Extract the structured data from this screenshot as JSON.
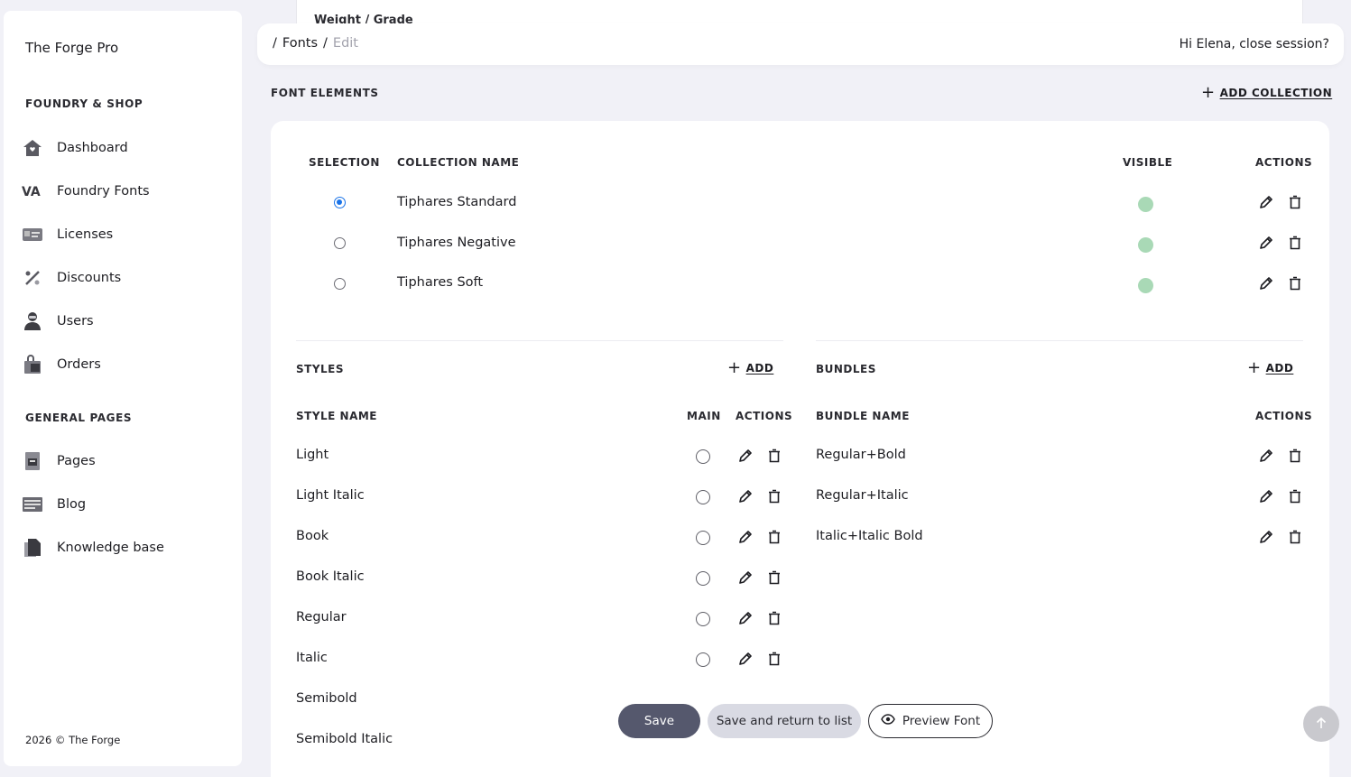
{
  "app": {
    "brand": "The Forge Pro",
    "footer": "2026 © The Forge"
  },
  "sidebar": {
    "section1": "FOUNDRY & SHOP",
    "items1": [
      {
        "label": "Dashboard",
        "icon": "home-icon"
      },
      {
        "label": "Foundry Fonts",
        "icon": "font-va-icon"
      },
      {
        "label": "Licenses",
        "icon": "license-card-icon"
      },
      {
        "label": "Discounts",
        "icon": "percent-icon"
      },
      {
        "label": "Users",
        "icon": "user-icon"
      },
      {
        "label": "Orders",
        "icon": "shopping-bag-icon"
      }
    ],
    "section2": "GENERAL PAGES",
    "items2": [
      {
        "label": "Pages",
        "icon": "page-icon"
      },
      {
        "label": "Blog",
        "icon": "blog-icon"
      },
      {
        "label": "Knowledge base",
        "icon": "documents-icon"
      }
    ]
  },
  "peek": {
    "label": "Weight / Grade"
  },
  "topbar": {
    "crumb_sep": "/",
    "crumb_fonts": "Fonts",
    "crumb_edit": "Edit",
    "greeting": "Hi Elena,  close session?"
  },
  "font_elements": {
    "title": "FONT ELEMENTS",
    "add_collection": "ADD COLLECTION",
    "headers": {
      "selection": "SELECTION",
      "name": "COLLECTION NAME",
      "visible": "VISIBLE",
      "actions": "ACTIONS"
    },
    "collections": [
      {
        "name": "Tiphares Standard",
        "selected": true
      },
      {
        "name": "Tiphares Negative",
        "selected": false
      },
      {
        "name": "Tiphares Soft",
        "selected": false
      }
    ]
  },
  "styles": {
    "title": "STYLES",
    "add": "ADD",
    "headers": {
      "name": "STYLE NAME",
      "main": "MAIN",
      "actions": "ACTIONS"
    },
    "rows": [
      "Light",
      "Light Italic",
      "Book",
      "Book Italic",
      "Regular",
      "Italic",
      "Semibold",
      "Semibold Italic"
    ]
  },
  "bundles": {
    "title": "BUNDLES",
    "add": "ADD",
    "headers": {
      "name": "BUNDLE NAME",
      "actions": "ACTIONS"
    },
    "rows": [
      "Regular+Bold",
      "Regular+Italic",
      "Italic+Italic Bold"
    ]
  },
  "actions_bar": {
    "save": "Save",
    "save_return": "Save and return to list",
    "preview": "Preview Font"
  },
  "colors": {
    "visible_dot": "#a9d9b6",
    "save_button": "#55586d",
    "radio_selected": "#1a73e8"
  }
}
